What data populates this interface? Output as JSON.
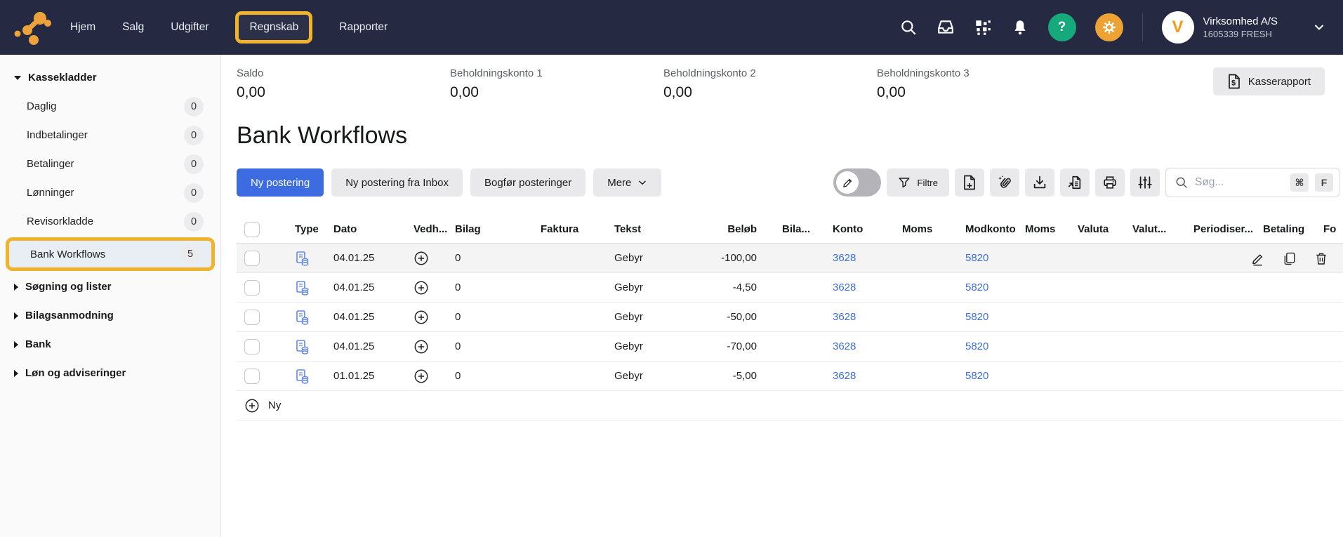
{
  "topnav": {
    "items": [
      {
        "label": "Hjem"
      },
      {
        "label": "Salg"
      },
      {
        "label": "Udgifter"
      },
      {
        "label": "Regnskab"
      },
      {
        "label": "Rapporter"
      }
    ],
    "help_label": "?",
    "account": {
      "name": "Virksomhed A/S",
      "number": "1605339 FRESH",
      "avatar_letter": "V"
    }
  },
  "sidebar": {
    "sections": [
      {
        "label": "Kassekladder",
        "expanded": true,
        "items": [
          {
            "label": "Daglig",
            "count": "0"
          },
          {
            "label": "Indbetalinger",
            "count": "0"
          },
          {
            "label": "Betalinger",
            "count": "0"
          },
          {
            "label": "Lønninger",
            "count": "0"
          },
          {
            "label": "Revisorkladde",
            "count": "0"
          },
          {
            "label": "Bank Workflows",
            "count": "5"
          }
        ]
      },
      {
        "label": "Søgning og lister"
      },
      {
        "label": "Bilagsanmodning"
      },
      {
        "label": "Bank"
      },
      {
        "label": "Løn og adviseringer"
      }
    ]
  },
  "summary": {
    "cards": [
      {
        "label": "Saldo",
        "value": "0,00"
      },
      {
        "label": "Beholdningskonto 1",
        "value": "0,00"
      },
      {
        "label": "Beholdningskonto 2",
        "value": "0,00"
      },
      {
        "label": "Beholdningskonto 3",
        "value": "0,00"
      }
    ],
    "report_button": "Kasserapport"
  },
  "page": {
    "title": "Bank Workflows"
  },
  "toolbar": {
    "primary": "Ny postering",
    "secondary_1": "Ny postering fra Inbox",
    "secondary_2": "Bogfør posteringer",
    "more": "Mere",
    "filter": "Filtre",
    "search": {
      "placeholder": "Søg...",
      "meta_key": "⌘",
      "key": "F"
    }
  },
  "table": {
    "headers": [
      "Type",
      "Dato",
      "Vedh...",
      "Bilag",
      "Faktura",
      "Tekst",
      "Beløb",
      "Bila...",
      "Konto",
      "Moms",
      "Modkonto",
      "Moms",
      "Valuta",
      "Valut...",
      "Periodiser...",
      "Betaling",
      "Fo"
    ],
    "rows": [
      {
        "dato": "04.01.25",
        "bilag": "0",
        "tekst": "Gebyr",
        "belob": "-100,00",
        "konto": "3628",
        "modkonto": "5820"
      },
      {
        "dato": "04.01.25",
        "bilag": "0",
        "tekst": "Gebyr",
        "belob": "-4,50",
        "konto": "3628",
        "modkonto": "5820"
      },
      {
        "dato": "04.01.25",
        "bilag": "0",
        "tekst": "Gebyr",
        "belob": "-50,00",
        "konto": "3628",
        "modkonto": "5820"
      },
      {
        "dato": "04.01.25",
        "bilag": "0",
        "tekst": "Gebyr",
        "belob": "-70,00",
        "konto": "3628",
        "modkonto": "5820"
      },
      {
        "dato": "01.01.25",
        "bilag": "0",
        "tekst": "Gebyr",
        "belob": "-5,00",
        "konto": "3628",
        "modkonto": "5820"
      }
    ],
    "new_row_label": "Ny"
  },
  "colors": {
    "topbar": "#252a42",
    "annotation": "#f0b42c",
    "primary_blue": "#3d6ce2",
    "link_blue": "#3e6fd9",
    "help_green": "#16a97c",
    "settings_orange": "#eda334",
    "logo_orange": "#eda23b"
  }
}
